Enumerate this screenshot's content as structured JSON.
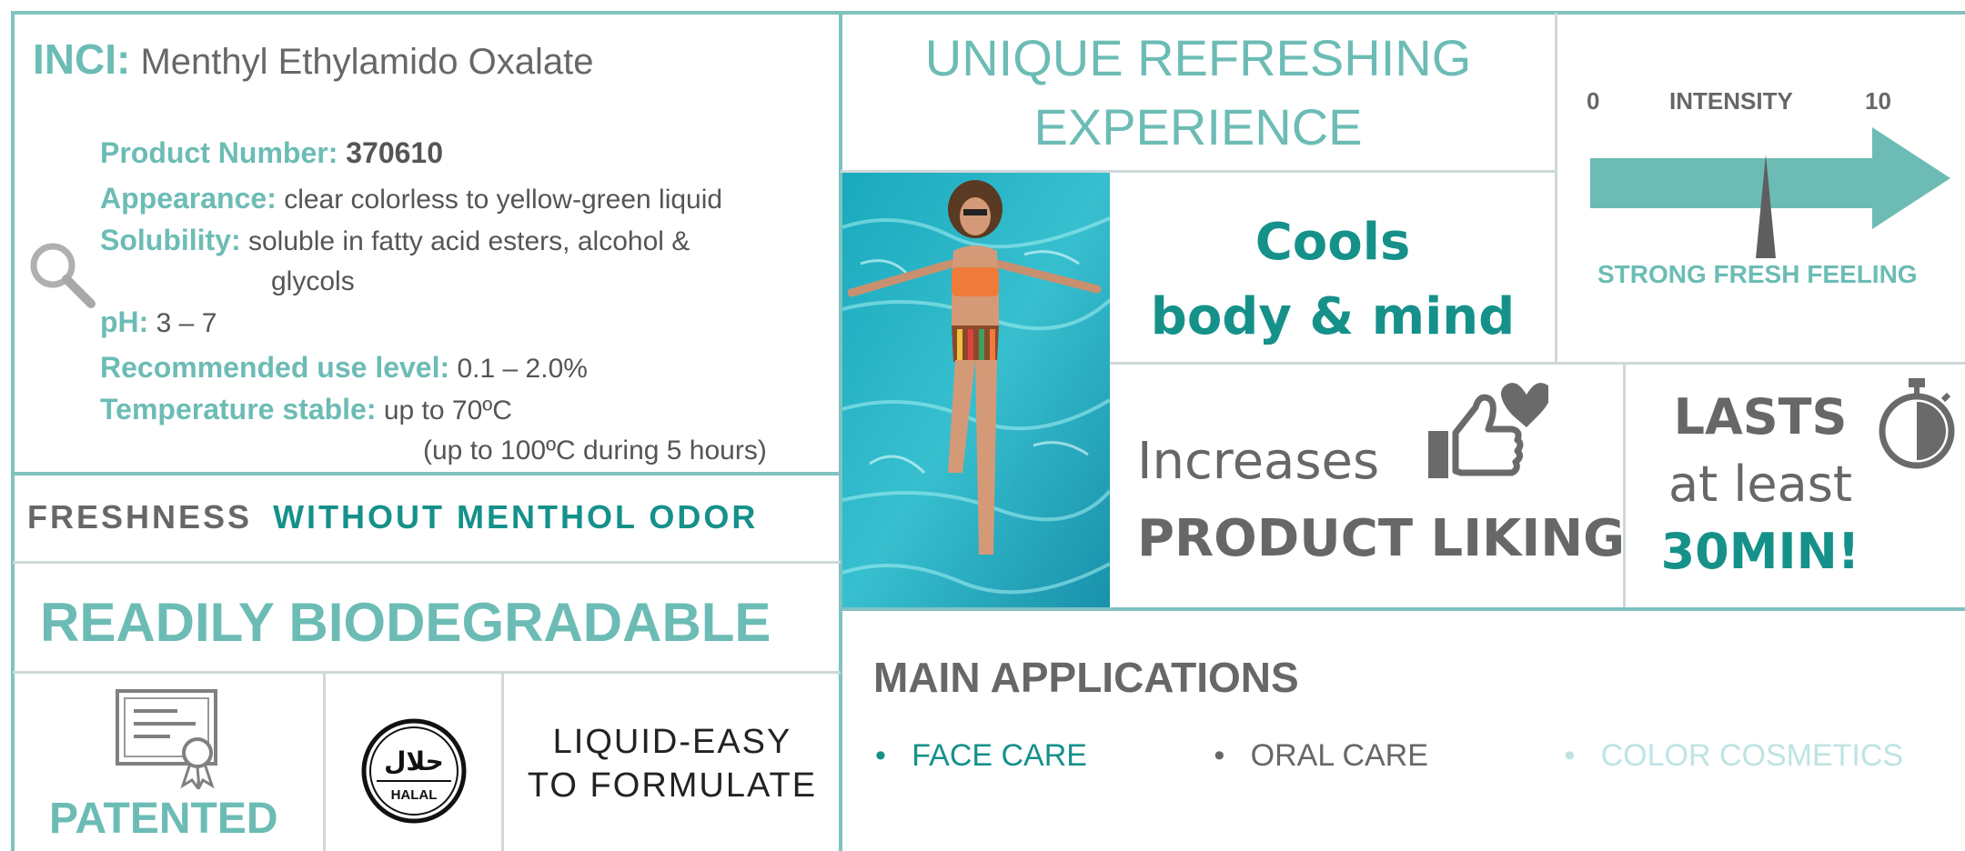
{
  "colors": {
    "teal": "#6cbcb5",
    "dark_teal": "#15918a",
    "grey": "#676767",
    "border": "#7fc2c0",
    "faded": "#bfe3e3"
  },
  "inci": {
    "label": "INCI:",
    "value": "Menthyl Ethylamido Oxalate"
  },
  "specs": {
    "product_number": {
      "label": "Product Number:",
      "value": "370610"
    },
    "appearance": {
      "label": "Appearance:",
      "value": "clear colorless to yellow-green liquid"
    },
    "solubility": {
      "label": "Solubility:",
      "value": "soluble in fatty acid esters, alcohol &",
      "value_cont": "glycols"
    },
    "ph": {
      "label": "pH:",
      "value": "3 – 7"
    },
    "use_level": {
      "label": "Recommended use level:",
      "value": "0.1 – 2.0%"
    },
    "temperature": {
      "label": "Temperature stable:",
      "value": "up to 70ºC",
      "value_cont": "(up to 100ºC during 5 hours)"
    }
  },
  "freshness": {
    "part1": "FRESHNESS",
    "part2": "WITHOUT MENTHOL ODOR"
  },
  "biodegradable": "READILY BIODEGRADABLE",
  "patented": "PATENTED",
  "halal": {
    "arabic": "حلال",
    "latin": "HALAL"
  },
  "liquid": {
    "line1": "LIQUID-EASY",
    "line2": "TO FORMULATE"
  },
  "headline": {
    "line1": "UNIQUE REFRESHING",
    "line2": "EXPERIENCE"
  },
  "intensity": {
    "min": "0",
    "label": "INTENSITY",
    "max": "10",
    "caption": "STRONG FRESH FEELING",
    "level": 0.5
  },
  "cools": {
    "line1": "Cools",
    "line2": "body & mind"
  },
  "liking": {
    "line1": "Increases",
    "line2": "PRODUCT LIKING"
  },
  "lasts": {
    "line1": "LASTS",
    "line2": "at least",
    "line3": "30MIN!"
  },
  "applications": {
    "title": "MAIN APPLICATIONS",
    "items": [
      {
        "label": "FACE CARE",
        "color": "#15918a"
      },
      {
        "label": "ORAL CARE",
        "color": "#676767"
      },
      {
        "label": "COLOR COSMETICS",
        "color": "#bfe3e3"
      }
    ]
  },
  "icons": [
    "magnifier-icon",
    "certificate-icon",
    "halal-icon",
    "thumbs-up-heart-icon",
    "stopwatch-icon",
    "intensity-arrow"
  ]
}
